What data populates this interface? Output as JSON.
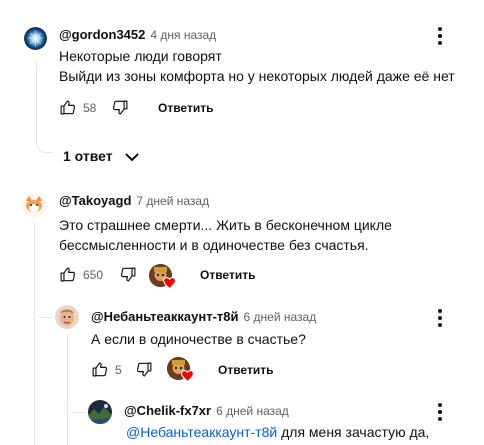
{
  "comments": [
    {
      "author": "@gordon3452",
      "time": "4 дня назад",
      "lines": [
        "Некоторые люди говорят",
        "Выйди из зоны комфорта но у некоторых людей даже её нет"
      ],
      "likes": "58",
      "reply_label": "Ответить",
      "replies_toggle": "1 ответ"
    },
    {
      "author": "@Takoyagd",
      "time": "7 дней назад",
      "lines": [
        "Это страшнее смерти... Жить в бесконечном цикле",
        "бессмысленности и в одиночестве без счастья."
      ],
      "likes": "650",
      "reply_label": "Ответить"
    },
    {
      "author": "@Небаньтеаккаунт-т8й",
      "time": "6 дней назад",
      "lines": [
        "А если в одиночестве в счастье?"
      ],
      "likes": "5",
      "reply_label": "Ответить"
    },
    {
      "author": "@Chelik-fx7xr",
      "time": "6 дней назад",
      "mention": "@Небаньтеаккаунт-т8й",
      "text_after_mention": " для меня зачастую да,"
    }
  ],
  "colors": {
    "text": "#0f0f0f",
    "secondary": "#606060",
    "mention": "#065fd4",
    "heart": "#ff0000",
    "thread_line": "#e5e5e5"
  },
  "icons": [
    "thumb-up-icon",
    "thumb-down-icon",
    "vertical-dots-icon",
    "chevron-down-icon",
    "heart-icon"
  ]
}
